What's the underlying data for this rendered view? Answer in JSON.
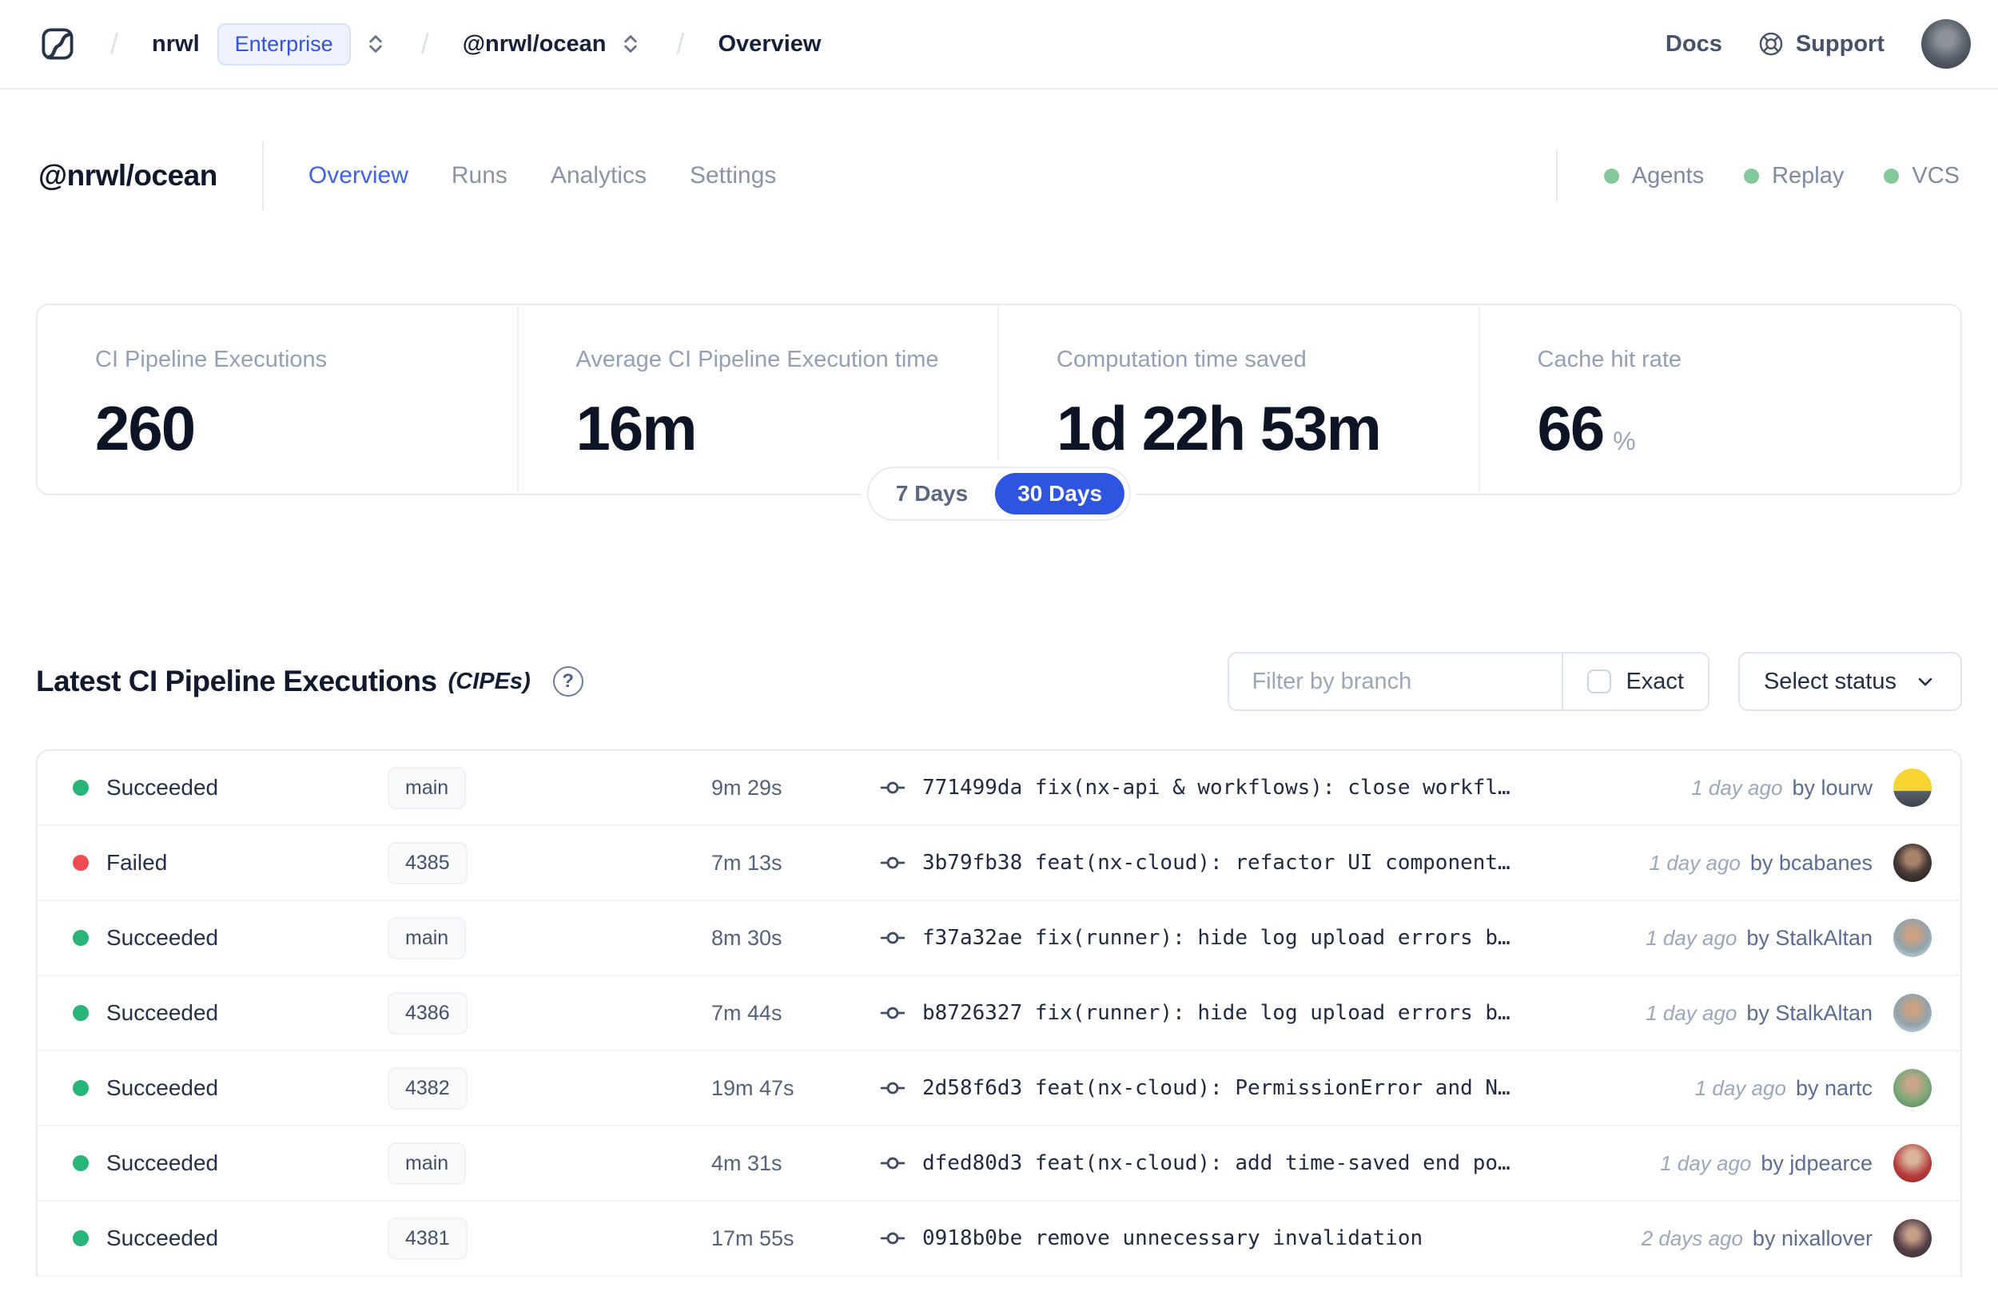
{
  "colors": {
    "accent_blue": "#2e55e0",
    "success_green": "#27b578",
    "failure_red": "#ef4b52",
    "indicator_green": "#84c99c"
  },
  "topbar": {
    "separator": "/",
    "org": "nrwl",
    "org_badge": "Enterprise",
    "workspace": "@nrwl/ocean",
    "page": "Overview",
    "docs": "Docs",
    "support": "Support",
    "avatar_bg": "radial-gradient(circle at 50% 40%, #8d9299 0 20%, #565d66 55%, #343a44 100%)"
  },
  "workspace_header": {
    "title": "@nrwl/ocean",
    "tabs": [
      {
        "label": "Overview",
        "active": true
      },
      {
        "label": "Runs",
        "active": false
      },
      {
        "label": "Analytics",
        "active": false
      },
      {
        "label": "Settings",
        "active": false
      }
    ],
    "statuses": [
      {
        "label": "Agents"
      },
      {
        "label": "Replay"
      },
      {
        "label": "VCS"
      }
    ]
  },
  "stats": {
    "cards": [
      {
        "label": "CI Pipeline Executions",
        "value": "260",
        "suffix": ""
      },
      {
        "label": "Average CI Pipeline Execution time",
        "value": "16m",
        "suffix": ""
      },
      {
        "label": "Computation time saved",
        "value": "1d 22h 53m",
        "suffix": ""
      },
      {
        "label": "Cache hit rate",
        "value": "66",
        "suffix": "%"
      }
    ],
    "range_toggle": {
      "options": [
        "7 Days",
        "30 Days"
      ],
      "selected": "30 Days"
    }
  },
  "cipe_section": {
    "title": "Latest CI Pipeline Executions",
    "title_suffix": "(CIPEs)",
    "help_icon": "?",
    "filter": {
      "branch_placeholder": "Filter by branch",
      "exact_label": "Exact",
      "status_button": "Select status"
    },
    "rows": [
      {
        "status": "Succeeded",
        "status_color": "green",
        "branch": "main",
        "duration": "9m 29s",
        "commit": "771499da fix(nx-api & workflows): close workfl…",
        "time": "1 day ago",
        "author": "by lourw",
        "avatar_bg": "linear-gradient(180deg, #f6d431 0%, #f6d431 58%, #5a626c 59%, #39414d 100%)"
      },
      {
        "status": "Failed",
        "status_color": "red",
        "branch": "4385",
        "duration": "7m 13s",
        "commit": "3b79fb38 feat(nx-cloud): refactor UI component…",
        "time": "1 day ago",
        "author": "by bcabanes",
        "avatar_bg": "radial-gradient(circle at 50% 38%, #a8826a 0 22%, #4a3c38 50%, #17181d 100%)"
      },
      {
        "status": "Succeeded",
        "status_color": "green",
        "branch": "main",
        "duration": "8m 30s",
        "commit": "f37a32ae fix(runner): hide log upload errors b…",
        "time": "1 day ago",
        "author": "by StalkAltan",
        "avatar_bg": "radial-gradient(circle at 50% 40%, #c9a184 0 20%, #8fa3ad 55%, #dfe7ec 100%)"
      },
      {
        "status": "Succeeded",
        "status_color": "green",
        "branch": "4386",
        "duration": "7m 44s",
        "commit": "b8726327 fix(runner): hide log upload errors b…",
        "time": "1 day ago",
        "author": "by StalkAltan",
        "avatar_bg": "radial-gradient(circle at 50% 40%, #c9a184 0 20%, #8fa3ad 55%, #dfe7ec 100%)"
      },
      {
        "status": "Succeeded",
        "status_color": "green",
        "branch": "4382",
        "duration": "19m 47s",
        "commit": "2d58f6d3 feat(nx-cloud): PermissionError and N…",
        "time": "1 day ago",
        "author": "by nartc",
        "avatar_bg": "radial-gradient(circle at 50% 40%, #caa58a 0 18%, #7da87a 55%, #4e7d52 100%)"
      },
      {
        "status": "Succeeded",
        "status_color": "green",
        "branch": "main",
        "duration": "4m 31s",
        "commit": "dfed80d3 feat(nx-cloud): add time-saved end po…",
        "time": "1 day ago",
        "author": "by jdpearce",
        "avatar_bg": "radial-gradient(circle at 50% 35%, #d9b49a 0 20%, #b33a3a 60%, #8e2a2a 100%)"
      },
      {
        "status": "Succeeded",
        "status_color": "green",
        "branch": "4381",
        "duration": "17m 55s",
        "commit": "0918b0be remove unnecessary invalidation",
        "time": "2 days ago",
        "author": "by nixallover",
        "avatar_bg": "radial-gradient(circle at 50% 40%, #c79e86 0 18%, #564149 55%, #2e2730 100%)"
      }
    ]
  }
}
